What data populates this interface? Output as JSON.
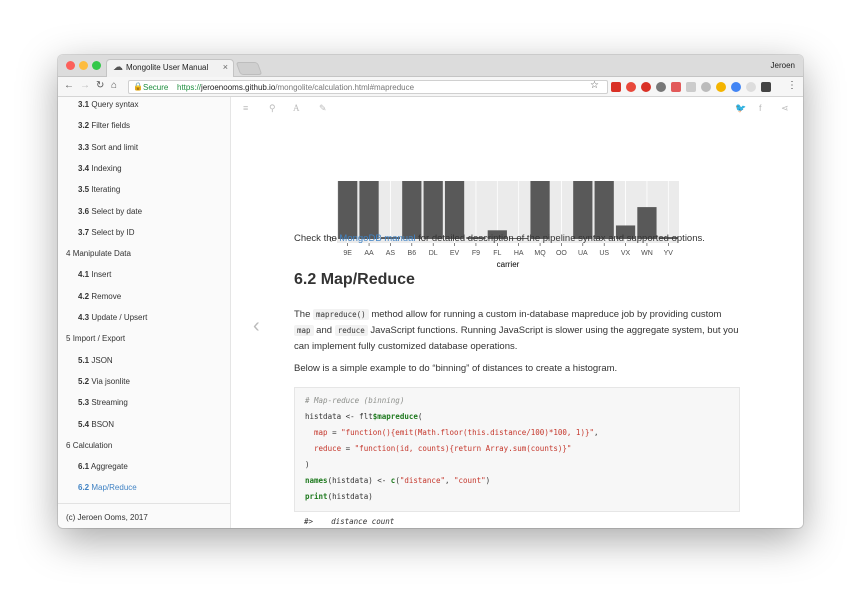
{
  "browser": {
    "tab_title": "Mongolite User Manual",
    "tab_close": "×",
    "user": "Jeroen",
    "secure_label": "Secure",
    "url_protocol": "https://",
    "url_domain": "jeroenooms.github.io",
    "url_path": "/mongolite/calculation.html#mapreduce"
  },
  "sidebar": {
    "items": [
      {
        "num": "3.1",
        "label": "Query syntax",
        "level": 2
      },
      {
        "num": "3.2",
        "label": "Filter fields",
        "level": 2
      },
      {
        "num": "3.3",
        "label": "Sort and limit",
        "level": 2
      },
      {
        "num": "3.4",
        "label": "Indexing",
        "level": 2
      },
      {
        "num": "3.5",
        "label": "Iterating",
        "level": 2
      },
      {
        "num": "3.6",
        "label": "Select by date",
        "level": 2
      },
      {
        "num": "3.7",
        "label": "Select by ID",
        "level": 2
      },
      {
        "num": "4",
        "label": "Manipulate Data",
        "level": 1
      },
      {
        "num": "4.1",
        "label": "Insert",
        "level": 2
      },
      {
        "num": "4.2",
        "label": "Remove",
        "level": 2
      },
      {
        "num": "4.3",
        "label": "Update / Upsert",
        "level": 2
      },
      {
        "num": "5",
        "label": "Import / Export",
        "level": 1
      },
      {
        "num": "5.1",
        "label": "JSON",
        "level": 2
      },
      {
        "num": "5.2",
        "label": "Via jsonlite",
        "level": 2
      },
      {
        "num": "5.3",
        "label": "Streaming",
        "level": 2
      },
      {
        "num": "5.4",
        "label": "BSON",
        "level": 2
      },
      {
        "num": "6",
        "label": "Calculation",
        "level": 1
      },
      {
        "num": "6.1",
        "label": "Aggregate",
        "level": 2
      },
      {
        "num": "6.2",
        "label": "Map/Reduce",
        "level": 2,
        "active": true
      }
    ],
    "footer": "(c) Jeroen Ooms, 2017"
  },
  "chart_data": {
    "type": "bar",
    "categories": [
      "9E",
      "AA",
      "AS",
      "B6",
      "DL",
      "EV",
      "F9",
      "FL",
      "HA",
      "MQ",
      "OO",
      "UA",
      "US",
      "VX",
      "WN",
      "YV"
    ],
    "values": [
      60,
      60,
      2,
      60,
      60,
      60,
      2,
      9,
      1,
      60,
      0,
      60,
      60,
      14,
      33,
      2
    ],
    "xlabel": "carrier",
    "ylabel": "",
    "ytick": "0",
    "ylim": [
      0,
      60
    ],
    "grid": true,
    "bar_color": "#595959",
    "panel_color": "#ebebeb"
  },
  "content": {
    "check_prefix": "Check the ",
    "check_link": "MongoDB manual",
    "check_suffix": " for detailed description of the pipeline syntax and supported options.",
    "heading": "6.2 Map/Reduce",
    "p1_a": "The ",
    "p1_code1": "mapreduce()",
    "p1_b": " method allow for running a custom in-database mapreduce job by providing custom ",
    "p1_code2": "map",
    "p1_c": " and ",
    "p1_code3": "reduce",
    "p1_d": " JavaScript functions. Running JavaScript is slower using the aggregate system, but you can implement fully customized database operations.",
    "p2": "Below is a simple example to do “binning” of distances to create a histogram."
  },
  "code": {
    "comment": "# Map-reduce (binning)",
    "l2a": "histdata <- flt",
    "l2b": "$mapreduce",
    "l2c": "(",
    "l3a": "  map",
    "l3b": " = ",
    "l3c": "\"function(){emit(Math.floor(this.distance/100)*100, 1)}\"",
    "l3d": ",",
    "l4a": "  reduce",
    "l4b": " = ",
    "l4c": "\"function(id, counts){return Array.sum(counts)}\"",
    "l5": ")",
    "l6a": "names",
    "l6b": "(histdata) <- ",
    "l6c": "c",
    "l6d": "(",
    "l6e": "\"distance\"",
    "l6f": ", ",
    "l6g": "\"count\"",
    "l6h": ")",
    "l7a": "print",
    "l7b": "(histdata)",
    "output": "#>    distance count"
  }
}
